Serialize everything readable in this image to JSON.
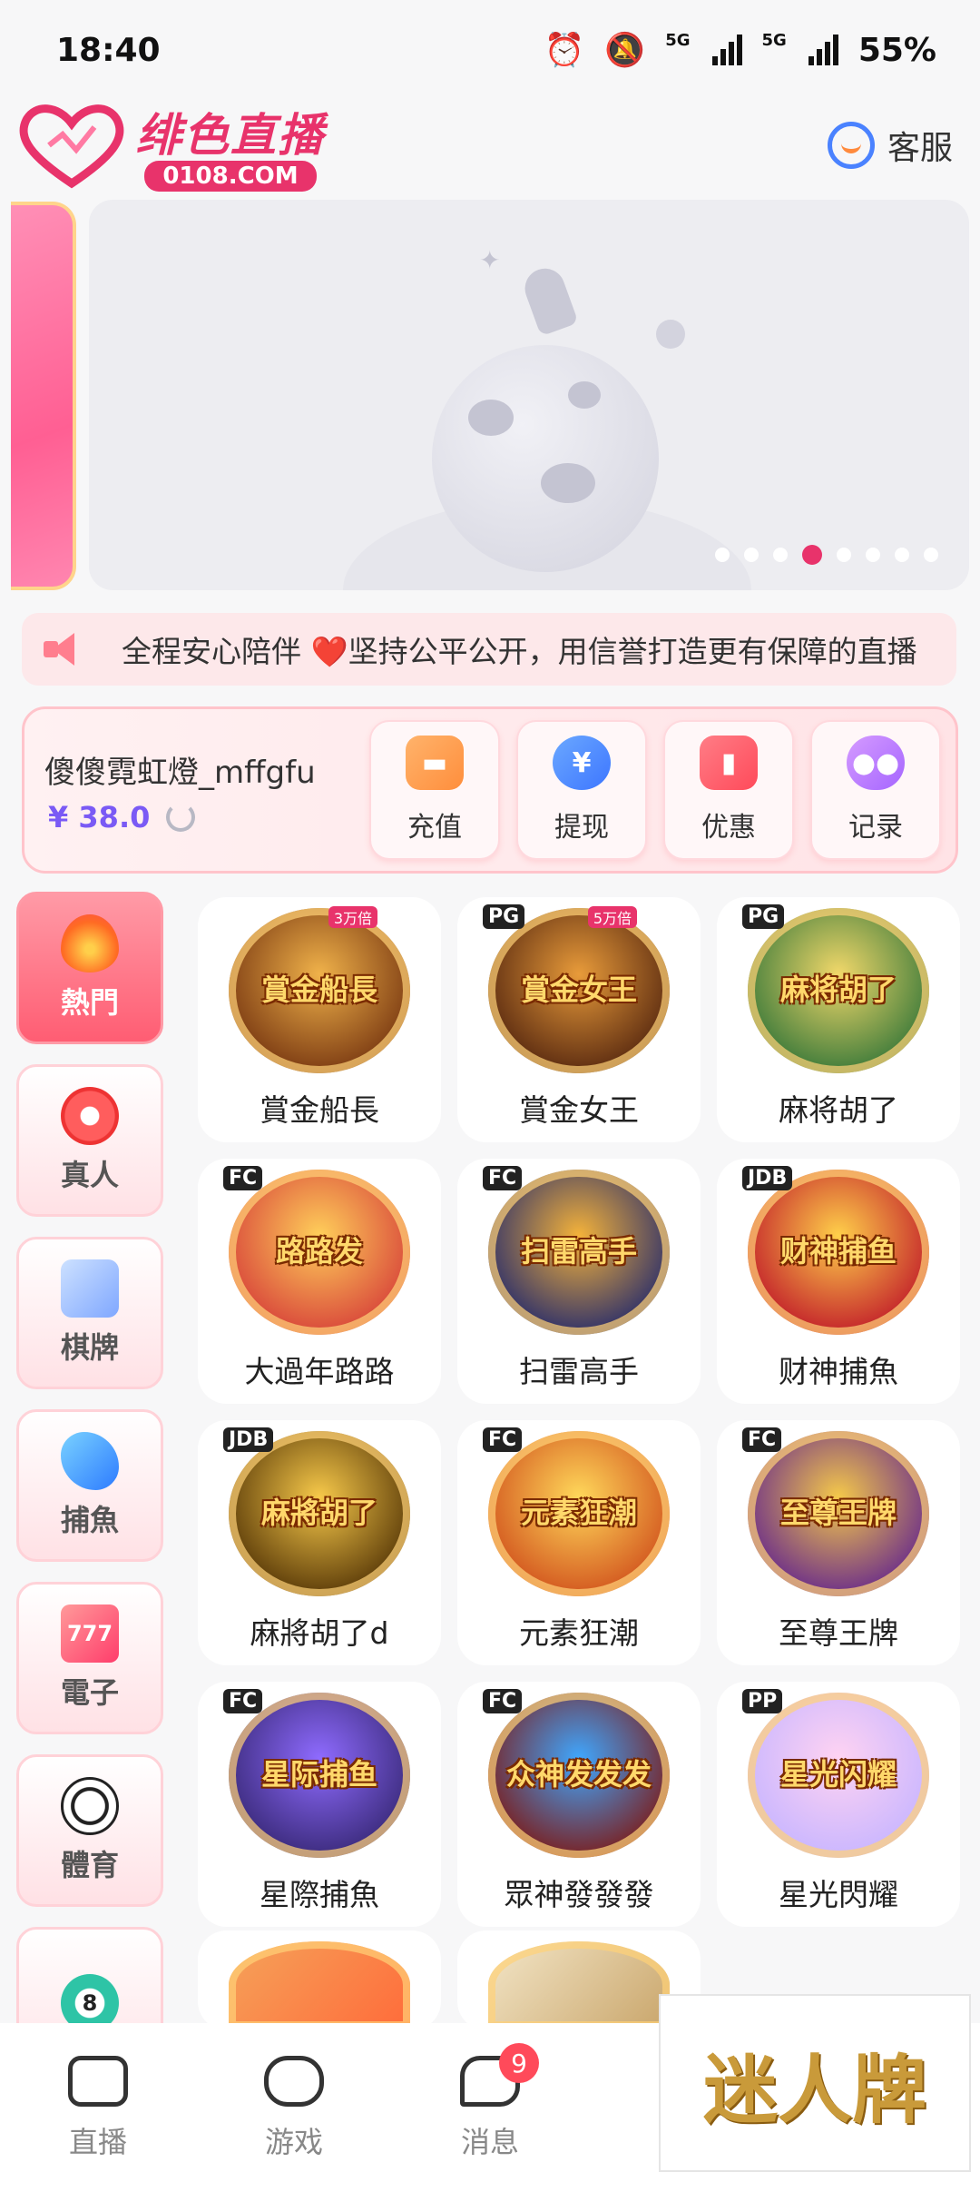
{
  "status_bar": {
    "time": "18:40",
    "network_1": "5G",
    "network_2": "5G",
    "battery": "55%"
  },
  "header": {
    "logo_title": "绯色直播",
    "logo_domain": "0108.COM",
    "service_label": "客服"
  },
  "banner": {
    "dot_count": 8,
    "active_index": 3
  },
  "notice": {
    "text": "全程安心陪伴 ❤️坚持公平公开，用信誉打造更有保障的直播"
  },
  "account": {
    "username": "傻傻霓虹燈_mffgfu",
    "balance": "¥ 38.0",
    "actions": [
      {
        "label": "充值",
        "icon": "wallet-icon"
      },
      {
        "label": "提现",
        "icon": "yen-icon"
      },
      {
        "label": "优惠",
        "icon": "coupon-icon"
      },
      {
        "label": "记录",
        "icon": "gamepad-icon"
      }
    ]
  },
  "categories": [
    {
      "label": "熱門",
      "icon": "flame-icon",
      "active": true
    },
    {
      "label": "真人",
      "icon": "chip-icon"
    },
    {
      "label": "棋牌",
      "icon": "cards-icon"
    },
    {
      "label": "捕魚",
      "icon": "shark-icon"
    },
    {
      "label": "電子",
      "icon": "slot-icon",
      "glyph": "777"
    },
    {
      "label": "體育",
      "icon": "soccer-icon"
    },
    {
      "label": "",
      "icon": "lottery-ball-icon",
      "glyph": "8"
    }
  ],
  "games": [
    {
      "name": "賞金船長",
      "thumb": "賞金船長",
      "provider": "",
      "multiplier": "3万倍",
      "colors": [
        "#7b3a12",
        "#f0b24a"
      ]
    },
    {
      "name": "賞金女王",
      "thumb": "賞金女王",
      "provider": "PG",
      "multiplier": "5万倍",
      "colors": [
        "#5a2a10",
        "#e89b3a"
      ]
    },
    {
      "name": "麻将胡了",
      "thumb": "麻将胡了",
      "provider": "PG",
      "multiplier": "",
      "colors": [
        "#3c7a3a",
        "#f2d86a"
      ]
    },
    {
      "name": "大過年路路",
      "thumb": "路路发",
      "provider": "FC",
      "multiplier": "",
      "colors": [
        "#d8453a",
        "#ffcf5a"
      ]
    },
    {
      "name": "扫雷高手",
      "thumb": "扫雷高手",
      "provider": "FC",
      "multiplier": "",
      "colors": [
        "#2c2f6a",
        "#f5b33a"
      ]
    },
    {
      "name": "财神捕魚",
      "thumb": "财神捕鱼",
      "provider": "JDB",
      "multiplier": "",
      "colors": [
        "#c21f2a",
        "#ffd04a"
      ]
    },
    {
      "name": "麻將胡了d",
      "thumb": "麻將胡了",
      "provider": "JDB",
      "multiplier": "",
      "colors": [
        "#5a3a08",
        "#f7c94a"
      ]
    },
    {
      "name": "元素狂潮",
      "thumb": "元素狂潮",
      "provider": "FC",
      "multiplier": "",
      "colors": [
        "#d2551e",
        "#ffd85a"
      ]
    },
    {
      "name": "至尊王牌",
      "thumb": "至尊王牌",
      "provider": "FC",
      "multiplier": "",
      "colors": [
        "#6a2c8a",
        "#f5c94a"
      ]
    },
    {
      "name": "星際捕魚",
      "thumb": "星际捕鱼",
      "provider": "FC",
      "multiplier": "",
      "colors": [
        "#3a2a7a",
        "#8f6bff"
      ]
    },
    {
      "name": "眾神發發發",
      "thumb": "众神发发发",
      "provider": "FC",
      "multiplier": "",
      "colors": [
        "#7a1f1f",
        "#3fa7ff"
      ]
    },
    {
      "name": "星光閃耀",
      "thumb": "星光闪耀",
      "provider": "PP",
      "multiplier": "",
      "colors": [
        "#c9b6ff",
        "#ffd3f2"
      ]
    }
  ],
  "bottom_nav": [
    {
      "label": "直播",
      "icon": "camera-icon"
    },
    {
      "label": "游戏",
      "icon": "gamepad-icon"
    },
    {
      "label": "消息",
      "icon": "message-icon",
      "badge": "9"
    }
  ],
  "promo": {
    "text": "迷人牌"
  }
}
